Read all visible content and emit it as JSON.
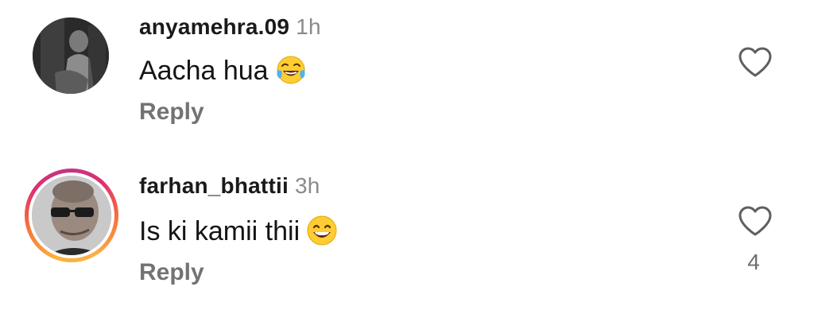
{
  "comments": [
    {
      "username": "anyamehra.09",
      "time": "1h",
      "text": "Aacha hua",
      "emoji": "face-with-tears-of-joy",
      "reply_label": "Reply",
      "like_count": "",
      "avatar_story_ring": false
    },
    {
      "username": "farhan_bhattii",
      "time": "3h",
      "text": "Is ki kamii thii",
      "emoji": "grinning-face-with-smiling-eyes",
      "reply_label": "Reply",
      "like_count": "4",
      "avatar_story_ring": true
    }
  ],
  "colors": {
    "username": "#1a1a1a",
    "time": "#8a8a8a",
    "reply": "#737373",
    "heart_stroke": "#5f5f5f",
    "story_ring": [
      "#fcaf45",
      "#f77737",
      "#e1306c",
      "#c13584"
    ]
  }
}
